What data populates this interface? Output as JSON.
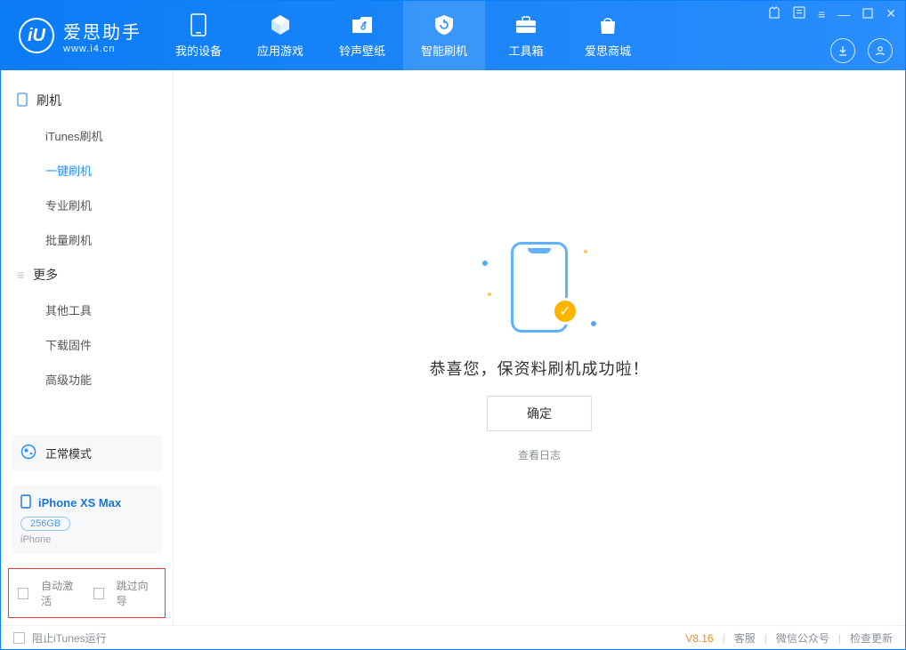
{
  "app": {
    "logo_main": "爱思助手",
    "logo_sub": "www.i4.cn",
    "logo_letter": "iU"
  },
  "nav": [
    {
      "label": "我的设备",
      "icon": "device"
    },
    {
      "label": "应用游戏",
      "icon": "cube"
    },
    {
      "label": "铃声壁纸",
      "icon": "music"
    },
    {
      "label": "智能刷机",
      "icon": "shield",
      "active": true
    },
    {
      "label": "工具箱",
      "icon": "briefcase"
    },
    {
      "label": "爱思商城",
      "icon": "bag"
    }
  ],
  "sidebar": {
    "section_flash": "刷机",
    "items_flash": [
      "iTunes刷机",
      "一键刷机",
      "专业刷机",
      "批量刷机"
    ],
    "active_flash_index": 1,
    "section_more": "更多",
    "items_more": [
      "其他工具",
      "下载固件",
      "高级功能"
    ],
    "mode_label": "正常模式",
    "device": {
      "name": "iPhone XS Max",
      "capacity": "256GB",
      "type": "iPhone"
    },
    "check_auto": "自动激活",
    "check_skip": "跳过向导"
  },
  "main": {
    "success_msg": "恭喜您，保资料刷机成功啦！",
    "ok_label": "确定",
    "log_link": "查看日志"
  },
  "footer": {
    "block_itunes": "阻止iTunes运行",
    "version": "V8.16",
    "service": "客服",
    "wechat": "微信公众号",
    "update": "检查更新"
  }
}
